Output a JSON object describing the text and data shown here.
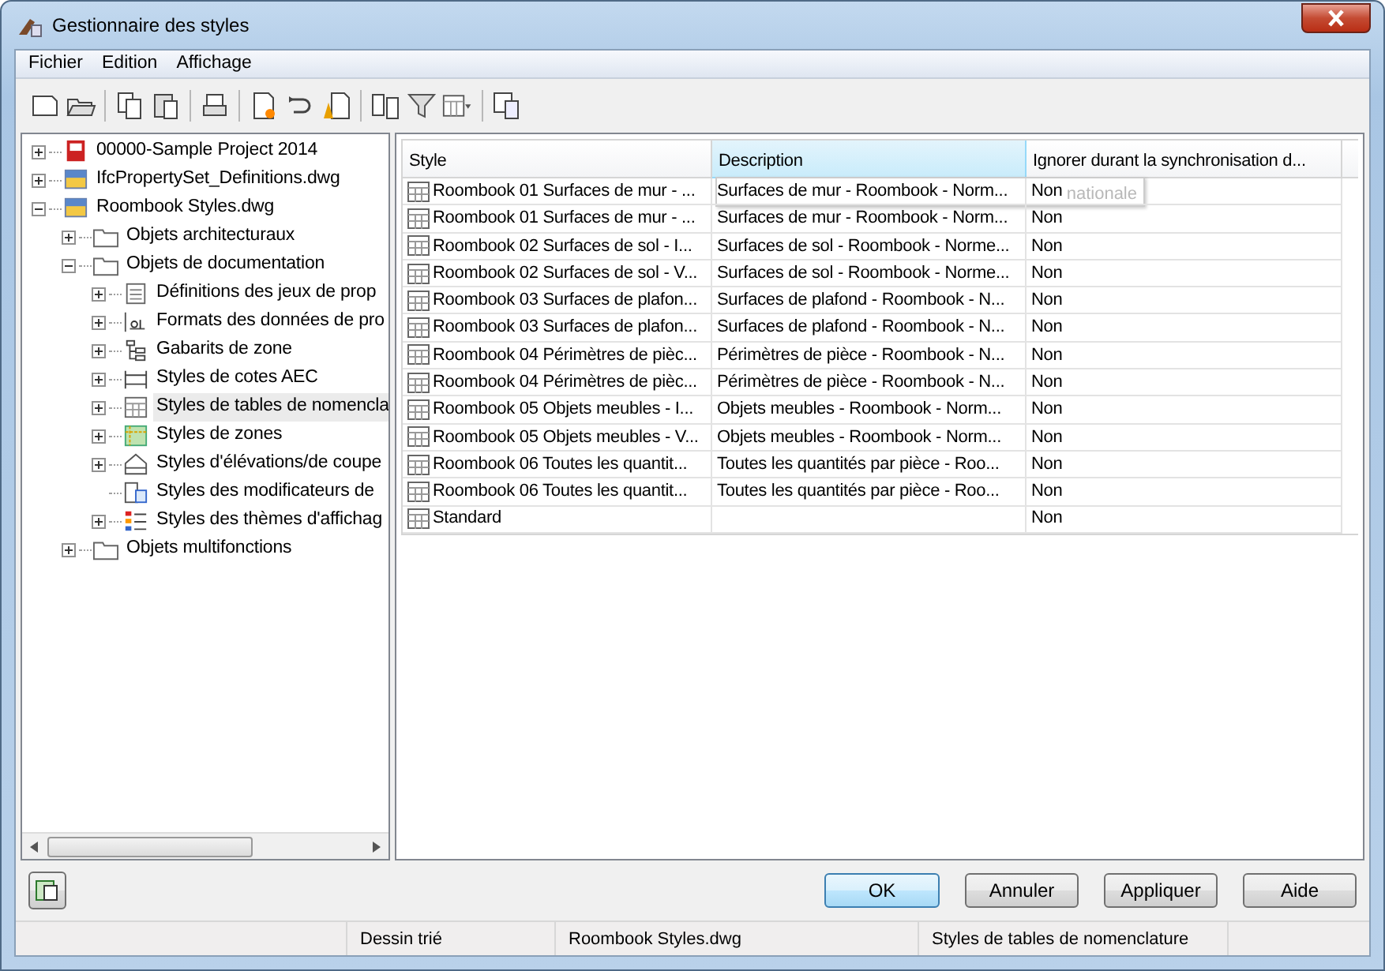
{
  "window": {
    "title": "Gestionnaire des styles"
  },
  "menu": [
    {
      "label": "Fichier"
    },
    {
      "label": "Edition"
    },
    {
      "label": "Affichage"
    }
  ],
  "toolbar": [
    {
      "kind": "new"
    },
    {
      "kind": "open"
    },
    {
      "kind": "sep"
    },
    {
      "kind": "copy"
    },
    {
      "kind": "paste"
    },
    {
      "kind": "sep"
    },
    {
      "kind": "purge"
    },
    {
      "kind": "sep"
    },
    {
      "kind": "new-style"
    },
    {
      "kind": "sync"
    },
    {
      "kind": "edit"
    },
    {
      "kind": "sep"
    },
    {
      "kind": "compare"
    },
    {
      "kind": "filter"
    },
    {
      "kind": "view"
    },
    {
      "kind": "sep"
    },
    {
      "kind": "toggle"
    }
  ],
  "tree": [
    {
      "label": "00000-Sample Project 2014",
      "kind": "project",
      "expanded": false,
      "selected": false
    },
    {
      "label": "IfcPropertySet_Definitions.dwg",
      "kind": "drawing",
      "expanded": false,
      "selected": false
    },
    {
      "label": "Roombook Styles.dwg",
      "kind": "drawing",
      "expanded": true,
      "selected": false,
      "children": [
        {
          "label": "Objets architecturaux",
          "kind": "folder",
          "expanded": false,
          "selected": false
        },
        {
          "label": "Objets de documentation",
          "kind": "folder",
          "expanded": true,
          "selected": false,
          "children": [
            {
              "label": "Définitions des jeux de prop",
              "kind": "property-set",
              "expanded": false,
              "selected": false
            },
            {
              "label": "Formats des données de pro",
              "kind": "data-format",
              "expanded": false,
              "selected": false
            },
            {
              "label": "Gabarits de zone",
              "kind": "zone-template",
              "expanded": false,
              "selected": false
            },
            {
              "label": "Styles de cotes AEC",
              "kind": "dimension",
              "expanded": false,
              "selected": false
            },
            {
              "label": "Styles de tables de nomencla",
              "kind": "schedule-table",
              "expanded": false,
              "selected": true
            },
            {
              "label": "Styles de zones",
              "kind": "zone",
              "expanded": false,
              "selected": false
            },
            {
              "label": "Styles d'élévations/de coupe",
              "kind": "elevation",
              "expanded": false,
              "selected": false
            },
            {
              "label": "Styles des modificateurs de",
              "kind": "modifier",
              "selected": false
            },
            {
              "label": "Styles des thèmes d'affichag",
              "kind": "display-theme",
              "expanded": false,
              "selected": false
            }
          ]
        },
        {
          "label": "Objets multifonctions",
          "kind": "folder",
          "expanded": false,
          "selected": false
        }
      ]
    }
  ],
  "table": {
    "columns": [
      {
        "label": "Style",
        "highlighted": false
      },
      {
        "label": "Description",
        "highlighted": true
      },
      {
        "label": "Ignorer durant la synchronisation d...",
        "highlighted": false
      }
    ],
    "rows": [
      {
        "style": "Roombook 01 Surfaces de mur - ...",
        "description": "Surfaces de mur - Roombook - Norm...",
        "ignore": "Non"
      },
      {
        "style": "Roombook 01 Surfaces de mur - ...",
        "description": "Surfaces de mur - Roombook - Norm...",
        "ignore": "Non"
      },
      {
        "style": "Roombook 02 Surfaces de sol - I...",
        "description": "Surfaces de sol - Roombook - Norme...",
        "ignore": "Non"
      },
      {
        "style": "Roombook 02 Surfaces de sol - V...",
        "description": "Surfaces de sol - Roombook - Norme...",
        "ignore": "Non"
      },
      {
        "style": "Roombook 03 Surfaces de plafon...",
        "description": "Surfaces de plafond - Roombook - N...",
        "ignore": "Non"
      },
      {
        "style": "Roombook 03 Surfaces de plafon...",
        "description": "Surfaces de plafond - Roombook - N...",
        "ignore": "Non"
      },
      {
        "style": "Roombook 04 Périmètres de pièc...",
        "description": "Périmètres de pièce - Roombook - N...",
        "ignore": "Non"
      },
      {
        "style": "Roombook 04 Périmètres de pièc...",
        "description": "Périmètres de pièce - Roombook - N...",
        "ignore": "Non"
      },
      {
        "style": "Roombook 05 Objets meubles - I...",
        "description": "Objets meubles - Roombook - Norm...",
        "ignore": "Non"
      },
      {
        "style": "Roombook 05 Objets meubles - V...",
        "description": "Objets meubles - Roombook - Norm...",
        "ignore": "Non"
      },
      {
        "style": "Roombook 06 Toutes les quantit...",
        "description": "Toutes les quantités par pièce - Roo...",
        "ignore": "Non"
      },
      {
        "style": "Roombook 06 Toutes les quantit...",
        "description": "Toutes les quantités par pièce - Roo...",
        "ignore": "Non"
      },
      {
        "style": "Standard",
        "ignore": "Non"
      }
    ],
    "tooltip": "nationale"
  },
  "buttons": [
    {
      "label": "OK",
      "default": true
    },
    {
      "label": "Annuler",
      "default": false
    },
    {
      "label": "Appliquer",
      "default": false
    },
    {
      "label": "Aide",
      "default": false
    }
  ],
  "status_bar": [
    "Dessin trié",
    "Roombook Styles.dwg",
    "Styles de tables de nomenclature"
  ]
}
